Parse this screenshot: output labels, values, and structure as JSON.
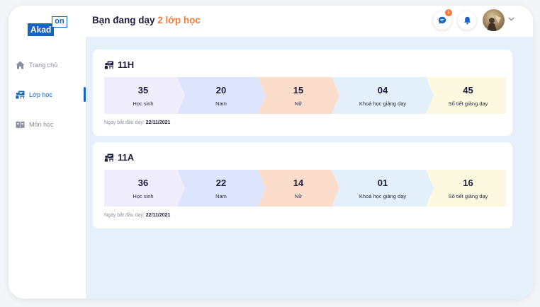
{
  "app": {
    "logo_main": "Akad",
    "logo_on": "on"
  },
  "sidebar": {
    "items": [
      {
        "label": "Trang chủ",
        "icon": "home-icon",
        "active": false
      },
      {
        "label": "Lớp học",
        "icon": "classroom-icon",
        "active": true
      },
      {
        "label": "Môn học",
        "icon": "book-icon",
        "active": false
      }
    ]
  },
  "header": {
    "title_prefix": "Bạn đang dạy",
    "title_highlight": "2 lớp học",
    "message_badge": "1"
  },
  "classes": [
    {
      "name": "11H",
      "stats": [
        {
          "value": "35",
          "label": "Học sinh"
        },
        {
          "value": "20",
          "label": "Nam"
        },
        {
          "value": "15",
          "label": "Nữ"
        },
        {
          "value": "04",
          "label": "Khoá học giảng dạy"
        },
        {
          "value": "45",
          "label": "Số tiết giảng dạy"
        }
      ],
      "start_label": "Ngày bắt đầu dạy:",
      "start_date": "22/11/2021"
    },
    {
      "name": "11A",
      "stats": [
        {
          "value": "36",
          "label": "Học sinh"
        },
        {
          "value": "22",
          "label": "Nam"
        },
        {
          "value": "14",
          "label": "Nữ"
        },
        {
          "value": "01",
          "label": "Khoá học giảng dạy"
        },
        {
          "value": "16",
          "label": "Số tiết giảng dạy"
        }
      ],
      "start_label": "Ngày bắt đầu dạy:",
      "start_date": "22/11/2021"
    }
  ],
  "colors": {
    "brand": "#1565c0",
    "accent": "#f5793b",
    "seg_students": "#efedfc",
    "seg_male": "#dce5fb",
    "seg_female": "#fcdccb",
    "seg_courses": "#e3effb",
    "seg_periods": "#fcf9e0",
    "main_bg": "#e6f0fb"
  }
}
